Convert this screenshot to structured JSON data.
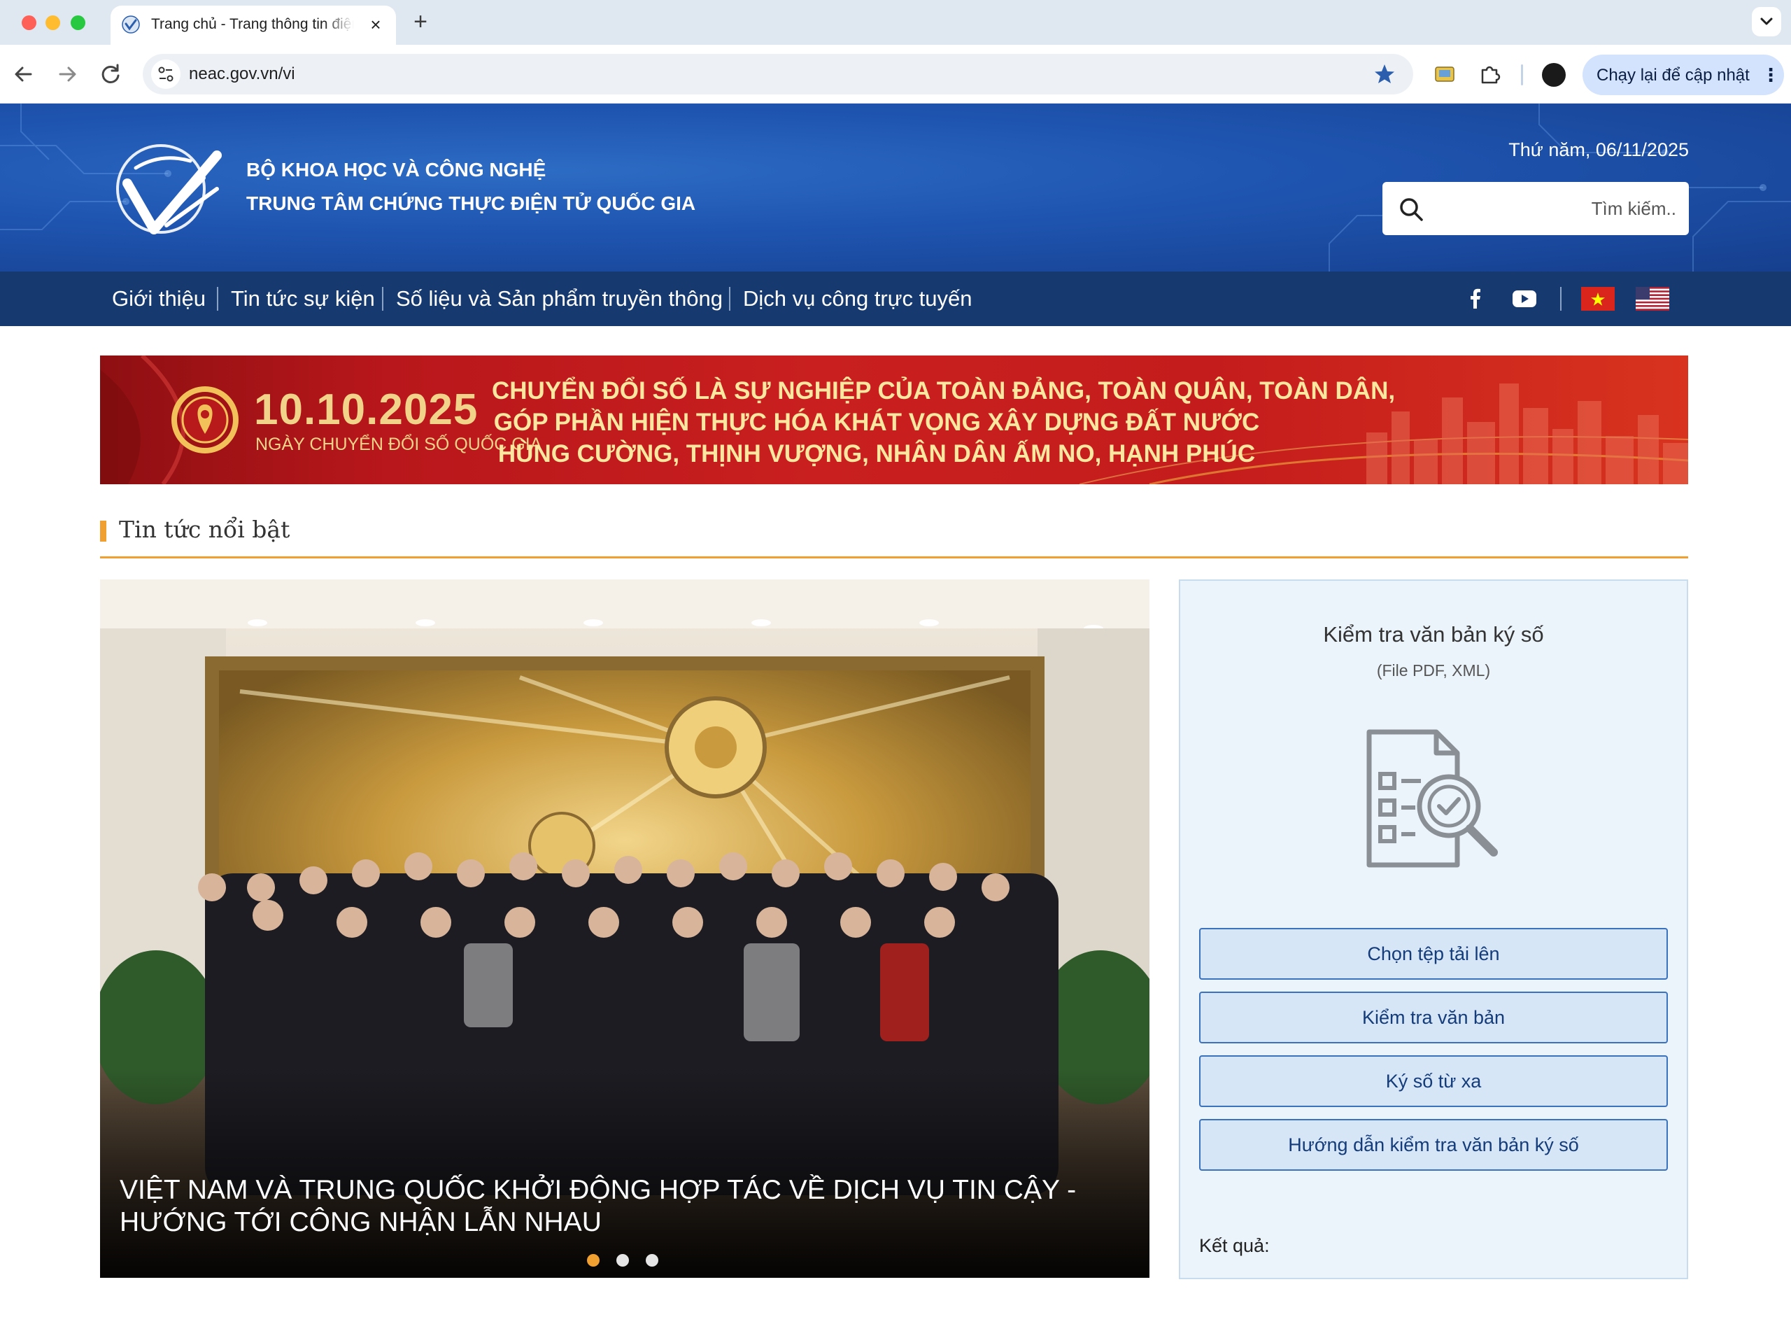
{
  "browser": {
    "tab_title": "Trang chủ - Trang thông tin điện tử",
    "url": "neac.gov.vn/vi",
    "update_button": "Chạy lại để cập nhật"
  },
  "header": {
    "org_line1": "BỘ KHOA HỌC VÀ CÔNG NGHỆ",
    "org_line2": "TRUNG TÂM CHỨNG THỰC ĐIỆN TỬ QUỐC GIA",
    "date": "Thứ năm, 06/11/2025",
    "search_placeholder": "Tìm kiếm.."
  },
  "nav": {
    "items": [
      "Giới thiệu",
      "Tin tức sự kiện",
      "Số liệu và Sản phẩm truyền thông",
      "Dịch vụ công trực tuyến"
    ]
  },
  "banner": {
    "date": "10.10.2025",
    "subtitle": "NGÀY CHUYỂN ĐỔI SỐ QUỐC GIA",
    "slogan": [
      "CHUYỂN ĐỔI SỐ LÀ SỰ NGHIỆP CỦA TOÀN ĐẢNG, TOÀN QUÂN, TOÀN DÂN,",
      "GÓP PHẦN HIỆN THỰC HÓA KHÁT VỌNG XÂY DỰNG ĐẤT NƯỚC",
      "HÙNG CƯỜNG, THỊNH VƯỢNG, NHÂN DÂN ẤM NO, HẠNH PHÚC"
    ]
  },
  "featured": {
    "section_title": "Tin tức nổi bật",
    "caption": "VIỆT NAM VÀ TRUNG QUỐC KHỞI ĐỘNG HỢP TÁC VỀ DỊCH VỤ TIN CẬY - HƯỚNG TỚI CÔNG NHẬN LẪN NHAU",
    "slide_count": 3,
    "active_slide": 1
  },
  "sign_check": {
    "title": "Kiểm tra văn bản ký số",
    "subtitle": "(File PDF, XML)",
    "buttons": [
      "Chọn tệp tải lên",
      "Kiểm tra văn bản",
      "Ký số từ xa",
      "Hướng dẫn kiểm tra văn bản ký số"
    ],
    "result_label": "Kết quả:"
  },
  "colors": {
    "header_blue": "#1f56b2",
    "nav_navy": "#163a70",
    "accent_orange": "#f0a030",
    "banner_red": "#c41c1c",
    "panel_bg": "#ebf3fb",
    "button_border": "#3a72bd"
  },
  "icons": {
    "tab_favicon": "neac-logo-icon",
    "search": "search-icon",
    "facebook": "facebook-icon",
    "youtube": "youtube-icon",
    "lang_vi": "vietnam-flag-icon",
    "lang_en": "us-flag-icon",
    "doc_check": "document-check-icon"
  }
}
